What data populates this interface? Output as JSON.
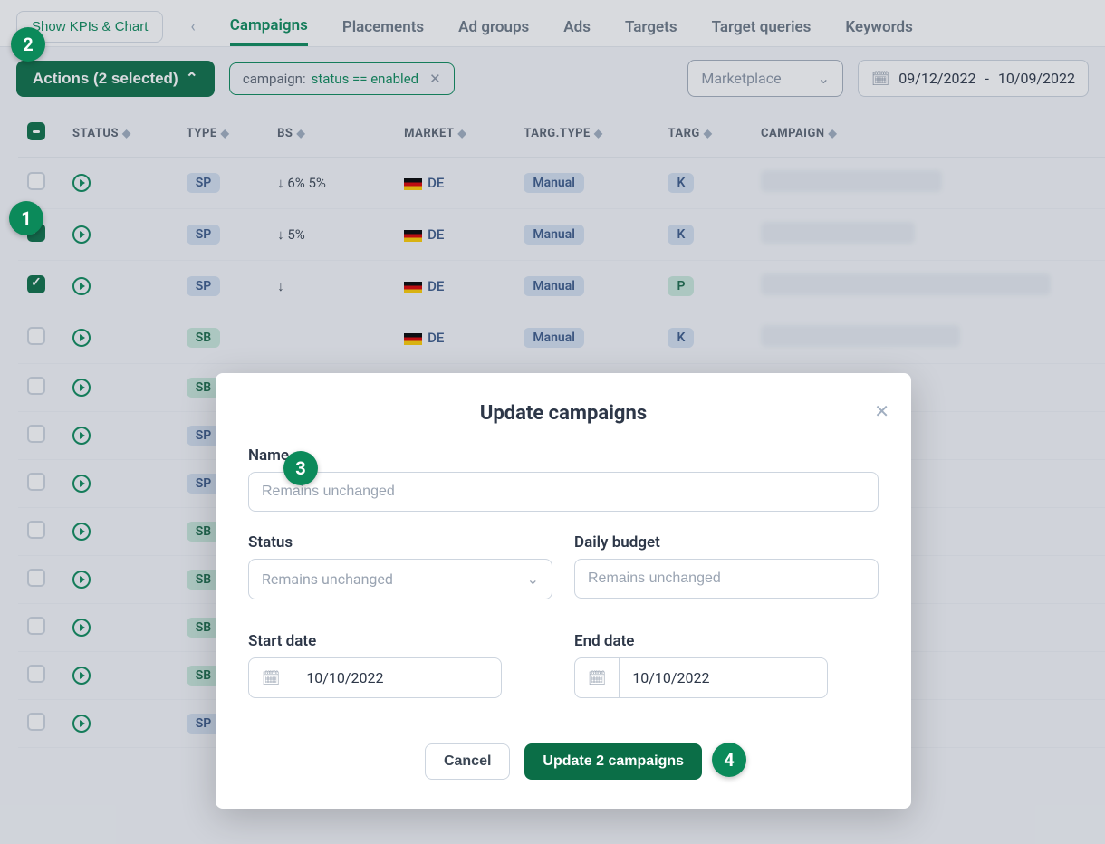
{
  "topbar": {
    "kpi_button": "Show KPIs & Chart",
    "tabs": [
      "Campaigns",
      "Placements",
      "Ad groups",
      "Ads",
      "Targets",
      "Target queries",
      "Keywords"
    ],
    "active_tab_index": 0
  },
  "filters": {
    "actions_label": "Actions (2 selected)",
    "chip_prefix": "campaign:",
    "chip_expr": "status == enabled",
    "marketplace_placeholder": "Marketplace",
    "date_from": "09/12/2022",
    "date_sep": "-",
    "date_to": "10/09/2022"
  },
  "table": {
    "headers": [
      "",
      "STATUS",
      "TYPE",
      "BS",
      "MARKET",
      "TARG.TYPE",
      "TARG",
      "CAMPAIGN"
    ],
    "rows": [
      {
        "checked": false,
        "type": "SP",
        "bs": "↓  6%   5%",
        "market": "DE",
        "targ_type": "Manual",
        "targ": "K",
        "blur_w": 200
      },
      {
        "checked": true,
        "type": "SP",
        "bs": "↓  5%",
        "market": "DE",
        "targ_type": "Manual",
        "targ": "K",
        "blur_w": 170
      },
      {
        "checked": true,
        "type": "SP",
        "bs": "↓",
        "market": "DE",
        "targ_type": "Manual",
        "targ": "P",
        "blur_w": 320
      },
      {
        "checked": false,
        "type": "SB",
        "bs": "",
        "market": "DE",
        "targ_type": "Manual",
        "targ": "K",
        "blur_w": 220
      },
      {
        "checked": false,
        "type": "SB",
        "bs": "",
        "market": "",
        "targ_type": "",
        "targ": "",
        "blur_w": 0
      },
      {
        "checked": false,
        "type": "SP",
        "bs": "",
        "market": "",
        "targ_type": "",
        "targ": "",
        "blur_w": 0
      },
      {
        "checked": false,
        "type": "SP",
        "bs": "",
        "market": "",
        "targ_type": "",
        "targ": "",
        "blur_w": 0
      },
      {
        "checked": false,
        "type": "SB",
        "bs": "",
        "market": "",
        "targ_type": "",
        "targ": "",
        "blur_w": 0
      },
      {
        "checked": false,
        "type": "SB",
        "bs": "",
        "market": "",
        "targ_type": "",
        "targ": "",
        "blur_w": 0
      },
      {
        "checked": false,
        "type": "SB",
        "bs": "",
        "market": "",
        "targ_type": "",
        "targ": "",
        "blur_w": 0
      },
      {
        "checked": false,
        "type": "SB",
        "bs": "",
        "market": "",
        "targ_type": "",
        "targ": "",
        "blur_w": 0
      },
      {
        "checked": false,
        "type": "SP",
        "bs": "",
        "market": "",
        "targ_type": "",
        "targ": "",
        "blur_w": 0
      }
    ]
  },
  "modal": {
    "title": "Update campaigns",
    "name_label": "Name",
    "name_placeholder": "Remains unchanged",
    "status_label": "Status",
    "status_placeholder": "Remains unchanged",
    "budget_label": "Daily budget",
    "budget_placeholder": "Remains unchanged",
    "start_label": "Start date",
    "start_value": "10/10/2022",
    "end_label": "End date",
    "end_value": "10/10/2022",
    "cancel": "Cancel",
    "submit": "Update 2 campaigns"
  },
  "markers": {
    "m1": "1",
    "m2": "2",
    "m3": "3",
    "m4": "4"
  }
}
